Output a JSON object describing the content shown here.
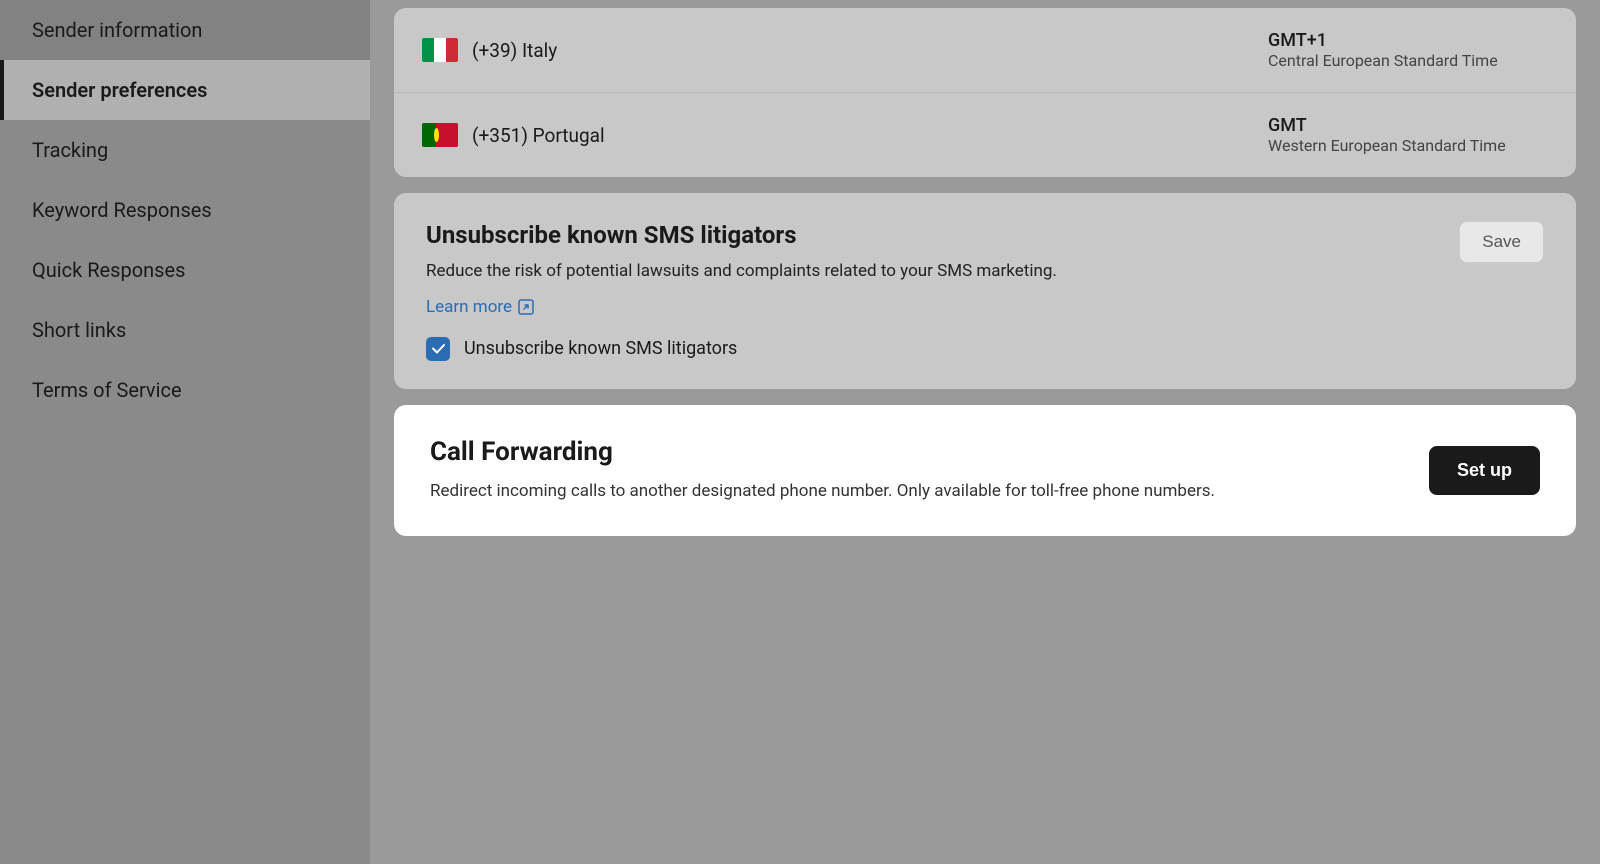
{
  "sidebar": {
    "items": [
      {
        "id": "sender-information",
        "label": "Sender information",
        "active": false
      },
      {
        "id": "sender-preferences",
        "label": "Sender preferences",
        "active": true
      },
      {
        "id": "tracking",
        "label": "Tracking",
        "active": false
      },
      {
        "id": "keyword-responses",
        "label": "Keyword Responses",
        "active": false
      },
      {
        "id": "quick-responses",
        "label": "Quick Responses",
        "active": false
      },
      {
        "id": "short-links",
        "label": "Short links",
        "active": false
      },
      {
        "id": "terms-of-service",
        "label": "Terms of Service",
        "active": false
      }
    ]
  },
  "phone_numbers": [
    {
      "country_code": "+39",
      "country": "Italy",
      "flag": "italy",
      "timezone_abbr": "GMT+1",
      "timezone_full": "Central European Standard Time"
    },
    {
      "country_code": "+351",
      "country": "Portugal",
      "flag": "portugal",
      "timezone_abbr": "GMT",
      "timezone_full": "Western European Standard Time"
    }
  ],
  "unsubscribe_section": {
    "title": "Unsubscribe known SMS litigators",
    "description": "Reduce the risk of potential lawsuits and complaints related to your SMS marketing.",
    "learn_more_label": "Learn more",
    "checkbox_label": "Unsubscribe known SMS litigators",
    "save_button_label": "Save"
  },
  "call_forwarding_section": {
    "title": "Call Forwarding",
    "description": "Redirect incoming calls to another designated phone number. Only available for toll-free phone numbers.",
    "setup_button_label": "Set up"
  }
}
